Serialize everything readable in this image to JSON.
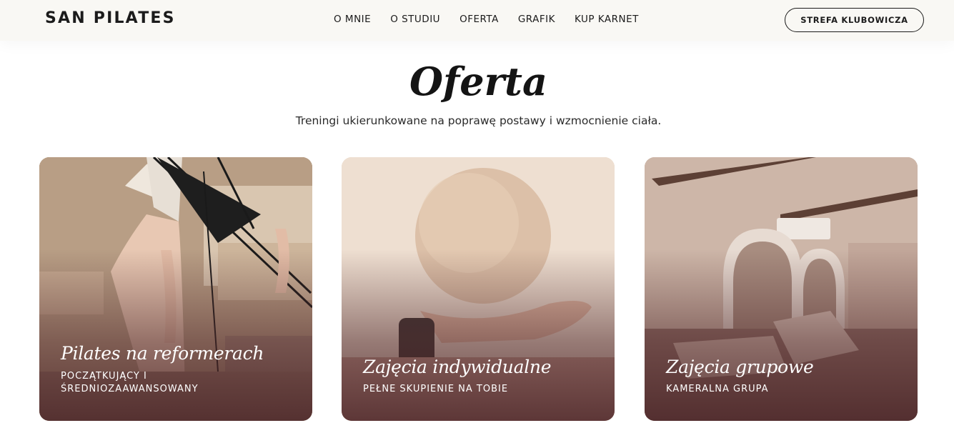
{
  "header": {
    "logo": "SAN PILATES",
    "nav": [
      "O MNIE",
      "O STUDIU",
      "OFERTA",
      "GRAFIK",
      "KUP KARNET"
    ],
    "cta_label": "STREFA KLUBOWICZA"
  },
  "main": {
    "title": "Oferta",
    "subtitle": "Treningi ukierunkowane na poprawę postawy i wzmocnienie ciała.",
    "cards": [
      {
        "title": "Pilates na reformerach",
        "subtitle_line1": "POCZĄTKUJĄCY I",
        "subtitle_line2": "ŚREDNIOZAAWANSOWANY"
      },
      {
        "title": "Zajęcia indywidualne",
        "subtitle_line1": "PEŁNE SKUPIENIE NA TOBIE"
      },
      {
        "title": "Zajęcia grupowe",
        "subtitle_line1": "KAMERALNA GRUPA"
      }
    ]
  },
  "colors": {
    "header_bg": "#f9f8f4",
    "text_dark": "#1b1b1b",
    "card_overlay": "#50282a"
  }
}
